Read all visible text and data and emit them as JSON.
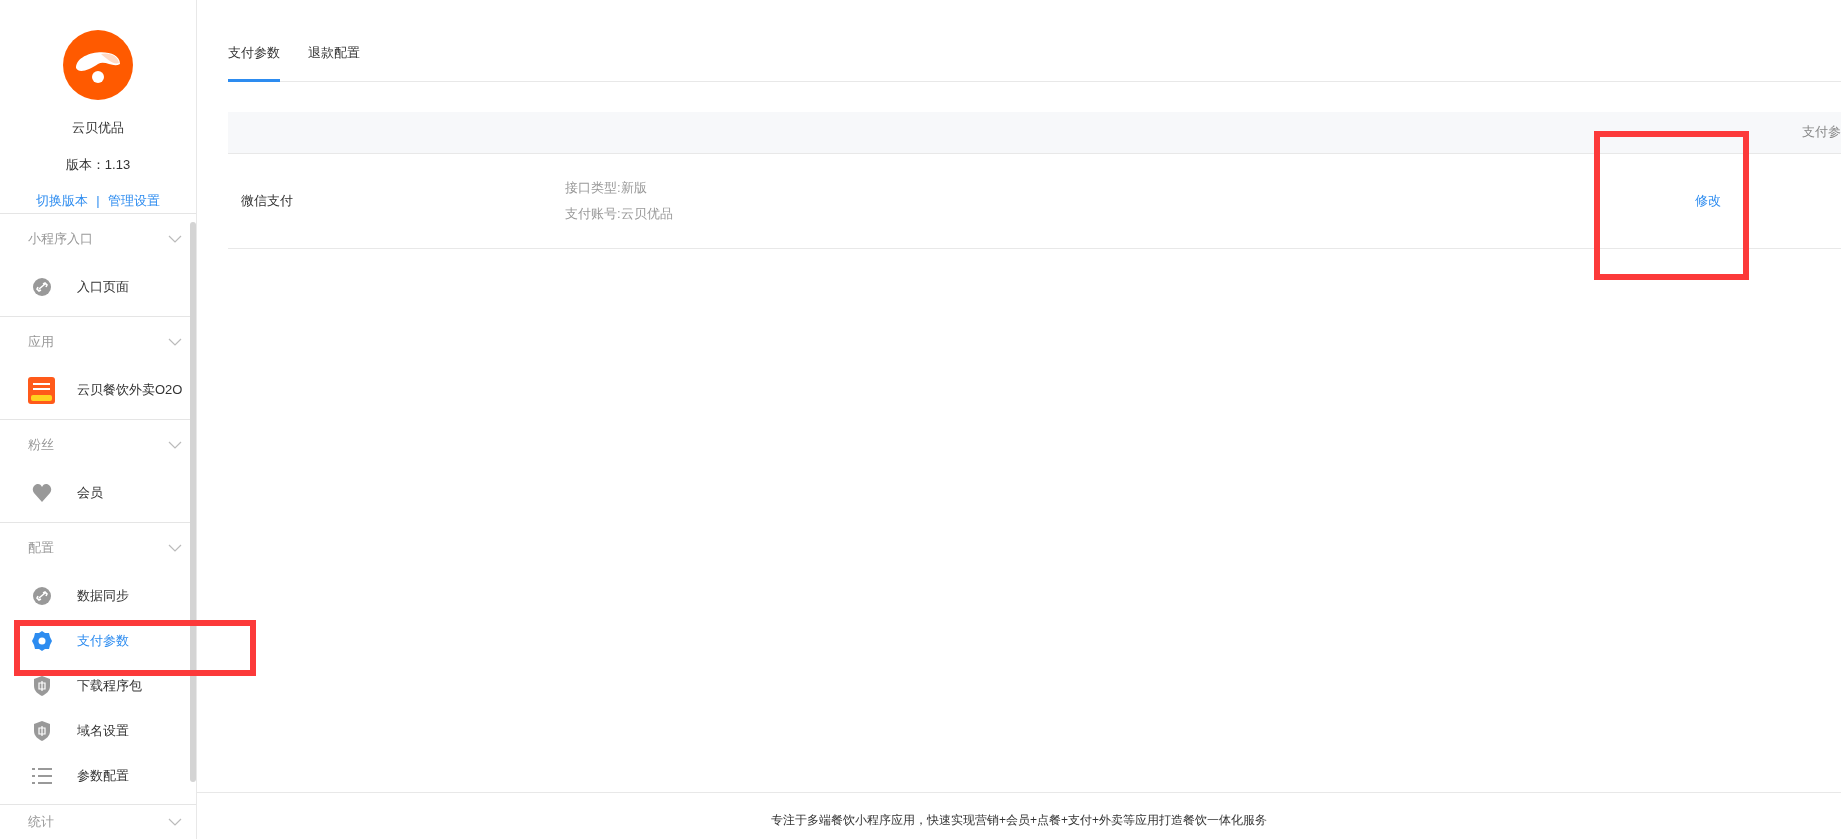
{
  "app": {
    "name": "云贝优品",
    "version": "版本：1.13",
    "links": [
      "切换版本",
      "管理设置"
    ],
    "separator": "|"
  },
  "sidebar": {
    "sections": [
      {
        "title": "小程序入口",
        "items": [
          {
            "label": "入口页面",
            "kind": "link",
            "selected": false
          }
        ]
      },
      {
        "title": "应用",
        "items": [
          {
            "label": "云贝餐饮外卖O2O",
            "kind": "app",
            "selected": false
          }
        ]
      },
      {
        "title": "粉丝",
        "items": [
          {
            "label": "会员",
            "kind": "heart",
            "selected": false
          }
        ]
      },
      {
        "title": "配置",
        "items": [
          {
            "label": "数据同步",
            "kind": "link",
            "selected": false
          },
          {
            "label": "支付参数",
            "kind": "gear",
            "selected": true
          },
          {
            "label": "下载程序包",
            "kind": "shield",
            "selected": false
          },
          {
            "label": "域名设置",
            "kind": "shield",
            "selected": false
          },
          {
            "label": "参数配置",
            "kind": "list",
            "selected": false
          }
        ]
      },
      {
        "title": "统计"
      }
    ]
  },
  "tabs": [
    {
      "label": "支付参数",
      "selected": true
    },
    {
      "label": "退款配置",
      "selected": false
    }
  ],
  "table": {
    "header_right": "支付参",
    "rows": [
      {
        "name": "微信支付",
        "details": [
          "接口类型:新版",
          "支付账号:云贝优品"
        ],
        "action": "修改"
      }
    ]
  },
  "footer": "专注于多端餐饮小程序应用，快速实现营销+会员+点餐+支付+外卖等应用打造餐饮一体化服务"
}
